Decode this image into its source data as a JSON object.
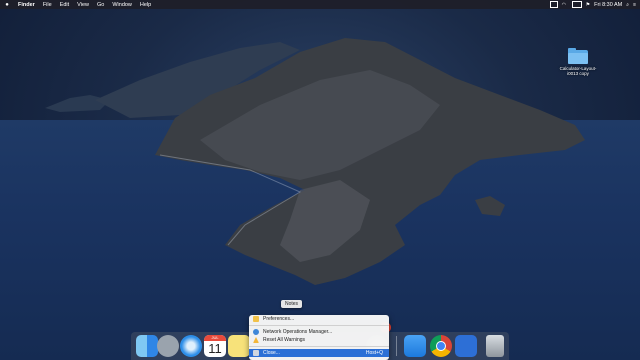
{
  "menubar": {
    "apple": "",
    "items": [
      "Finder",
      "File",
      "Edit",
      "View",
      "Go",
      "Window",
      "Help"
    ],
    "clock": "Fri 8:30 AM"
  },
  "desktop": {
    "folder_label": "Calculator-Layout-i0013 copy"
  },
  "dock": {
    "tooltip": "Notes",
    "calendar_month": "JUL",
    "calendar_day": "11",
    "settings_badge": "2"
  },
  "context_menu": {
    "items": [
      {
        "label": "Preferences..."
      },
      {
        "label": "Network Operations Manager..."
      },
      {
        "label": "Reset All Warnings"
      },
      {
        "label": "Close...",
        "shortcut": "Host+Q"
      }
    ]
  },
  "colors": {
    "accent": "#2b6fd6",
    "badge": "#e8412f"
  }
}
